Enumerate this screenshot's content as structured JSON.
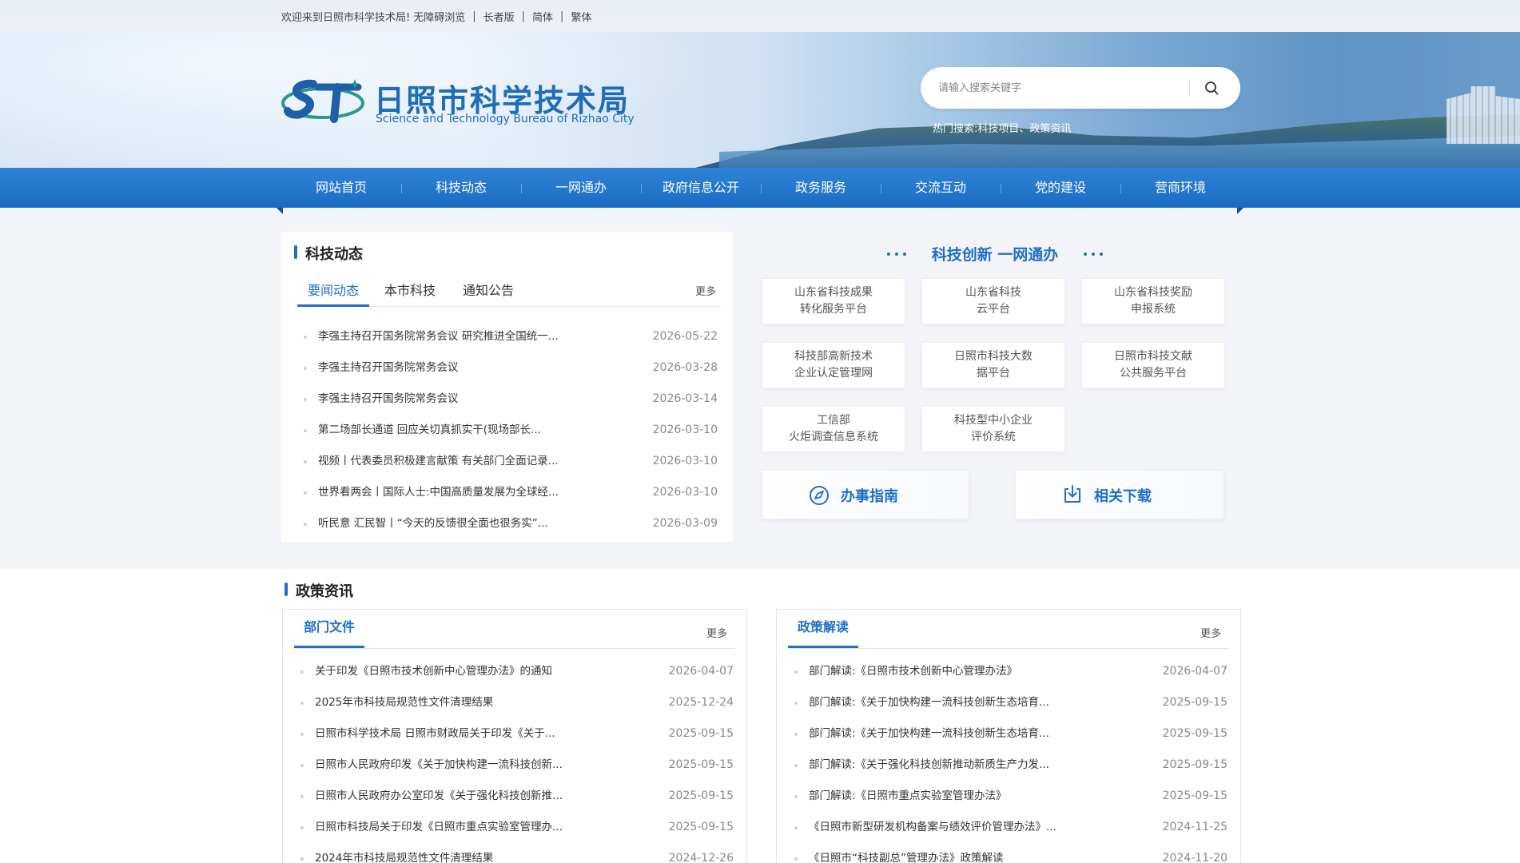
{
  "topbar": {
    "welcome": "欢迎来到日照市科学技术局!",
    "accessible": "无障碍浏览",
    "elder": "长者版",
    "simplified": "简体",
    "traditional": "繁体"
  },
  "header": {
    "logo_cn": "日照市科学技术局",
    "logo_en": "Science and Technology Bureau of Rizhao City",
    "search_placeholder": "请输入搜索关键字",
    "hot_search": "热门搜索:科技项目、政策资讯"
  },
  "nav": [
    "网站首页",
    "科技动态",
    "一网通办",
    "政府信息公开",
    "政务服务",
    "交流互动",
    "党的建设",
    "营商环境"
  ],
  "news": {
    "title": "科技动态",
    "tabs": [
      "要闻动态",
      "本市科技",
      "通知公告"
    ],
    "more": "更多",
    "items": [
      {
        "title": "李强主持召开国务院常务会议 研究推进全国统一...",
        "date": "2026-05-22"
      },
      {
        "title": "李强主持召开国务院常务会议",
        "date": "2026-03-28"
      },
      {
        "title": "李强主持召开国务院常务会议",
        "date": "2026-03-14"
      },
      {
        "title": "第二场部长通道 回应关切真抓实干(现场部长...",
        "date": "2026-03-10"
      },
      {
        "title": "视频丨代表委员积极建言献策 有关部门全面记录...",
        "date": "2026-03-10"
      },
      {
        "title": "世界看两会丨国际人士:中国高质量发展为全球经...",
        "date": "2026-03-10"
      },
      {
        "title": "听民意 汇民智丨“今天的反馈很全面也很务实”...",
        "date": "2026-03-09"
      }
    ]
  },
  "services": {
    "title": "科技创新 一网通办",
    "items": [
      [
        "山东省科技成果",
        "转化服务平台"
      ],
      [
        "山东省科技",
        "云平台"
      ],
      [
        "山东省科技奖励",
        "申报系统"
      ],
      [
        "科技部高新技术",
        "企业认定管理网"
      ],
      [
        "日照市科技大数",
        "据平台"
      ],
      [
        "日照市科技文献",
        "公共服务平台"
      ],
      [
        "工信部",
        "火炬调查信息系统"
      ],
      [
        "科技型中小企业",
        "评价系统"
      ]
    ],
    "guide": "办事指南",
    "download": "相关下载"
  },
  "policy": {
    "title": "政策资讯",
    "left": {
      "tab": "部门文件",
      "more": "更多",
      "items": [
        {
          "title": "关于印发《日照市技术创新中心管理办法》的通知",
          "date": "2026-04-07"
        },
        {
          "title": "2025年市科技局规范性文件清理结果",
          "date": "2025-12-24"
        },
        {
          "title": "日照市科学技术局 日照市财政局关于印发《关于...",
          "date": "2025-09-15"
        },
        {
          "title": "日照市人民政府印发《关于加快构建一流科技创新...",
          "date": "2025-09-15"
        },
        {
          "title": "日照市人民政府办公室印发《关于强化科技创新推...",
          "date": "2025-09-15"
        },
        {
          "title": "日照市科技局关于印发《日照市重点实验室管理办...",
          "date": "2025-09-15"
        },
        {
          "title": "2024年市科技局规范性文件清理结果",
          "date": "2024-12-26"
        }
      ]
    },
    "right": {
      "tab": "政策解读",
      "more": "更多",
      "items": [
        {
          "title": "部门解读:《日照市技术创新中心管理办法》",
          "date": "2026-04-07"
        },
        {
          "title": "部门解读:《关于加快构建一流科技创新生态培育...",
          "date": "2025-09-15"
        },
        {
          "title": "部门解读:《关于加快构建一流科技创新生态培育...",
          "date": "2025-09-15"
        },
        {
          "title": "部门解读:《关于强化科技创新推动新质生产力发...",
          "date": "2025-09-15"
        },
        {
          "title": "部门解读:《日照市重点实验室管理办法》",
          "date": "2025-09-15"
        },
        {
          "title": "《日照市新型研发机构备案与绩效评价管理办法》...",
          "date": "2024-11-25"
        },
        {
          "title": "《日照市“科技副总”管理办法》政策解读",
          "date": "2024-11-20"
        }
      ]
    }
  },
  "colors": {
    "brand": "#1d6fc7",
    "nav": "#1a6cc3"
  }
}
